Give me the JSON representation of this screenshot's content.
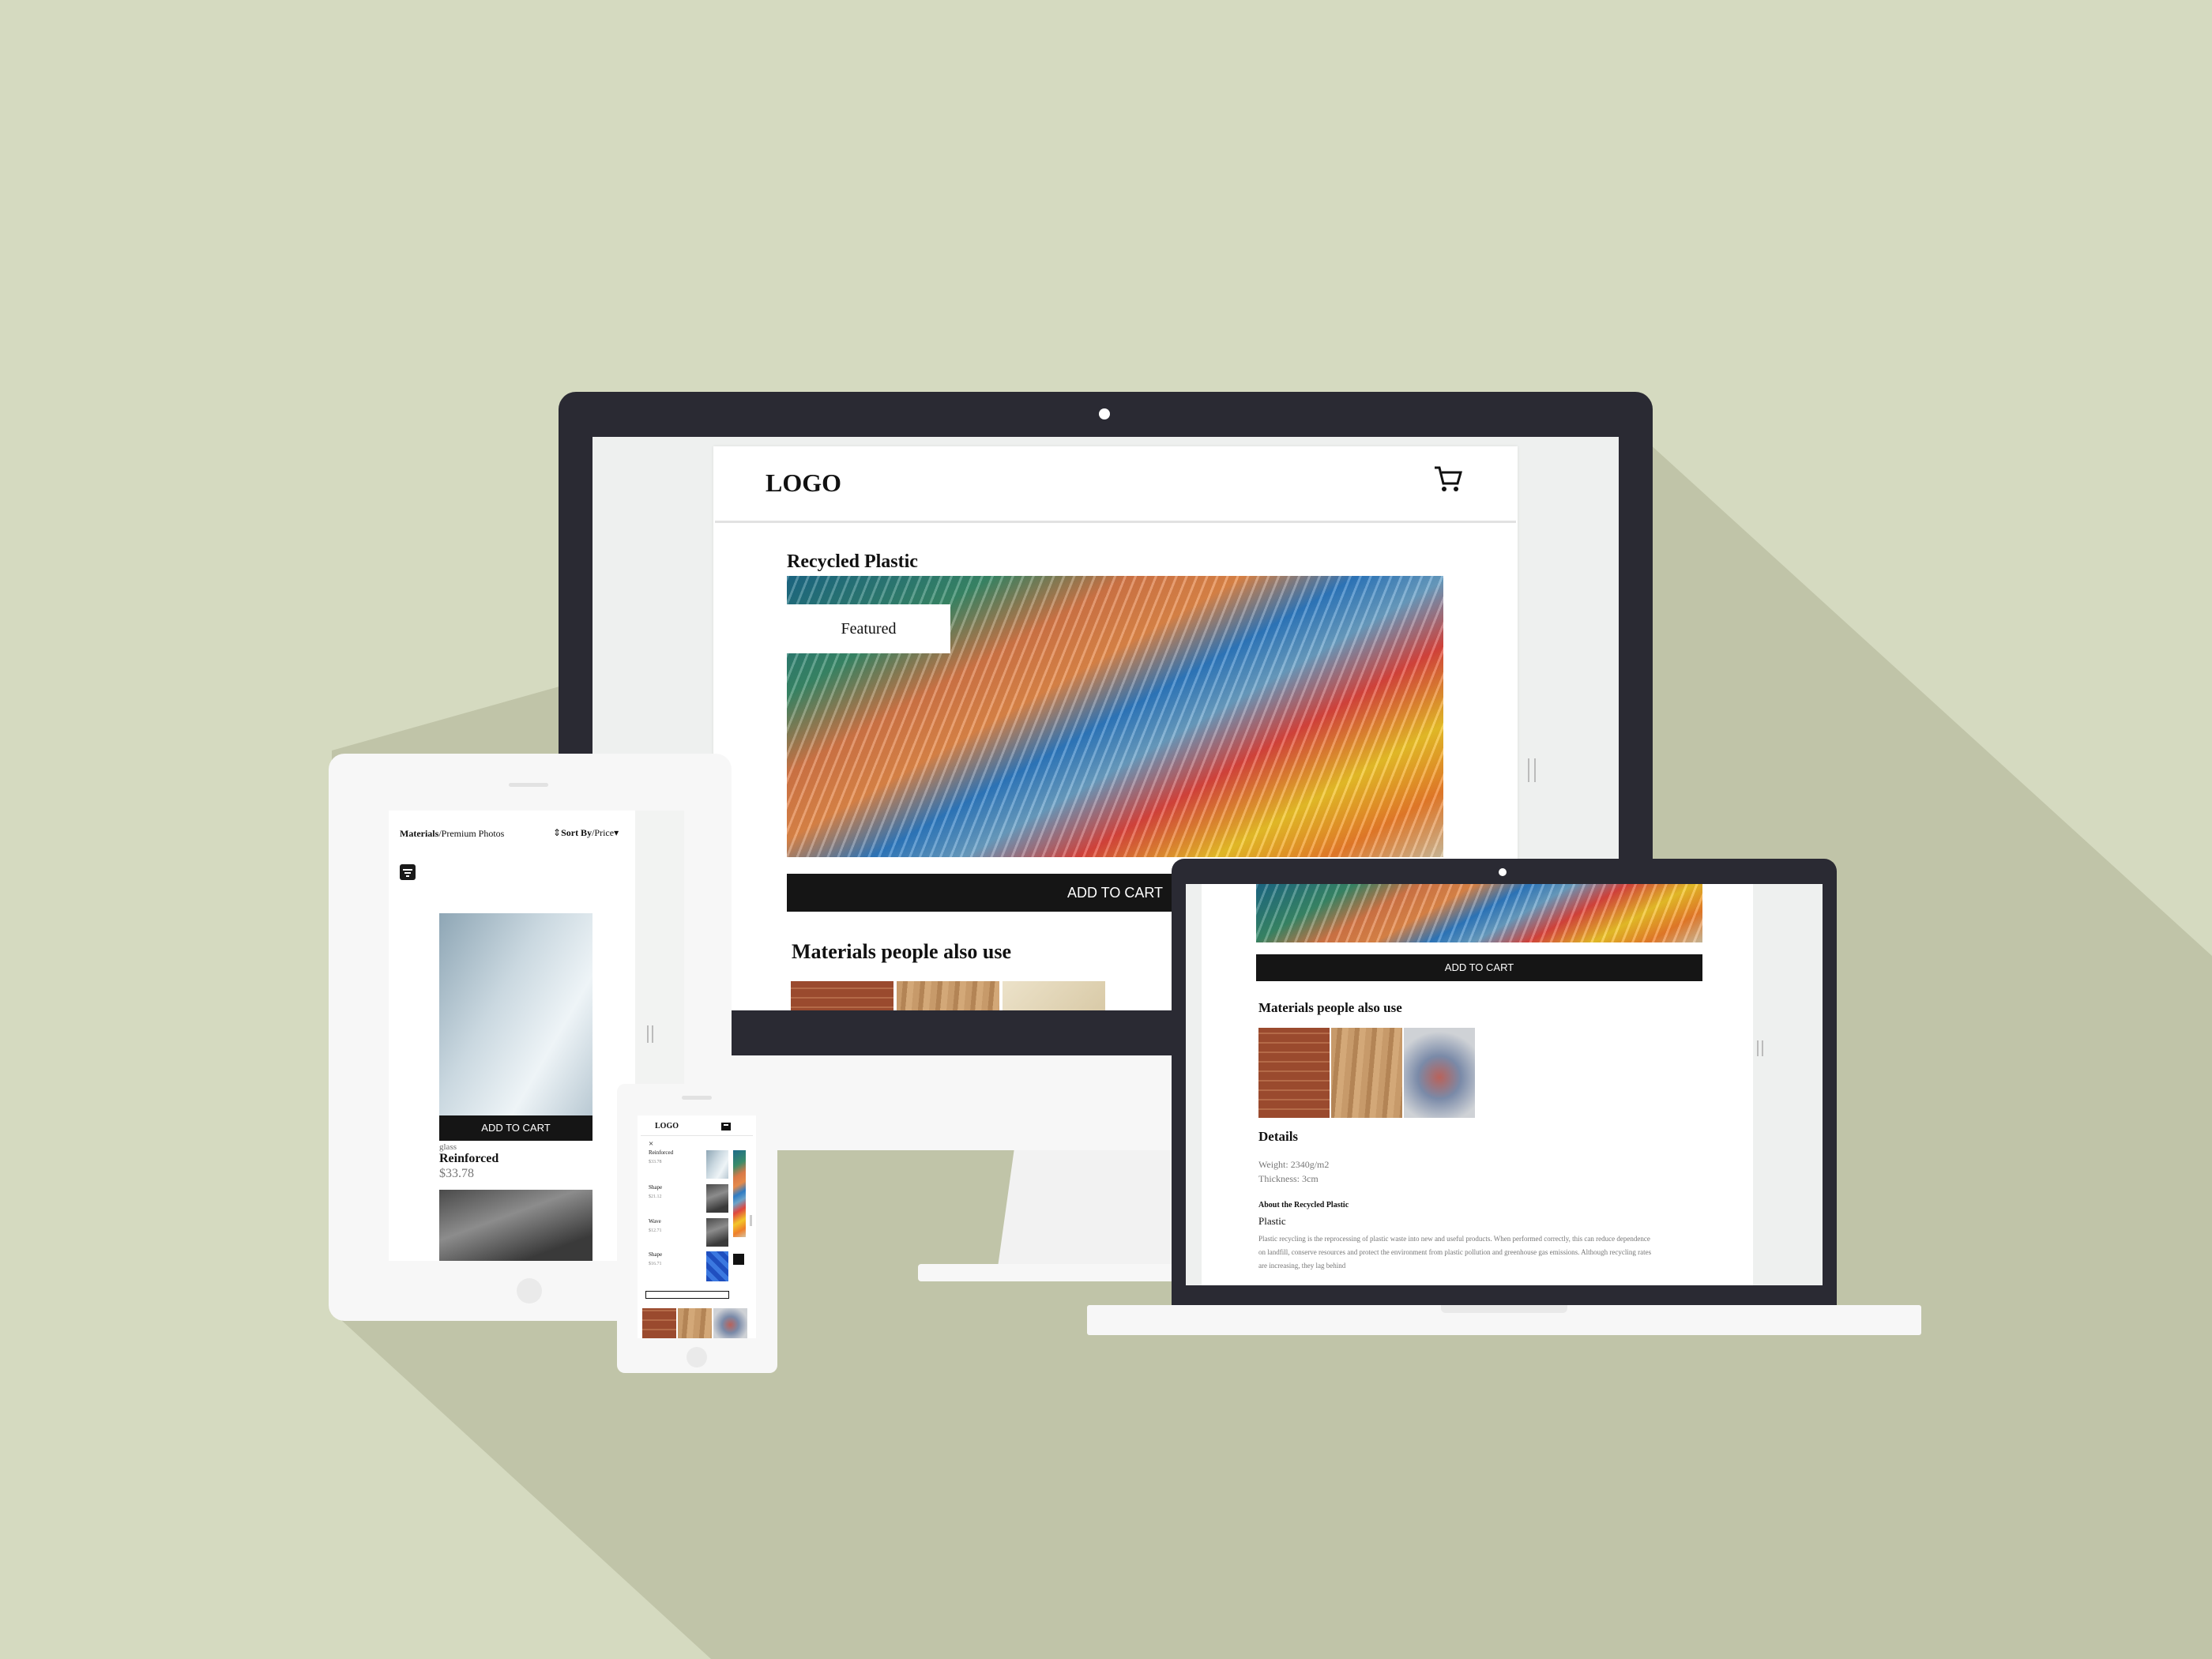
{
  "desktop": {
    "logo": "LOGO",
    "product_title": "Recycled Plastic",
    "featured_badge": "Featured",
    "add_to_cart": "ADD TO CART",
    "also_use_heading": "Materials people also use"
  },
  "tablet": {
    "breadcrumb_root": "Materials",
    "breadcrumb_sep": "/",
    "breadcrumb_page": "Premium Photos",
    "sort_label": "Sort By",
    "sort_value": "/Price",
    "add_to_cart": "ADD TO CART",
    "product_category": "glass",
    "product_name": "Reinforced",
    "product_price": "$33.78"
  },
  "phone": {
    "logo": "LOGO",
    "close": "×",
    "items": [
      {
        "name": "Reinforced",
        "price": "$33.78"
      },
      {
        "name": "Shape",
        "price": "$21.12"
      },
      {
        "name": "Wave",
        "price": "$12.71"
      },
      {
        "name": "Shape",
        "price": "$16.71"
      }
    ]
  },
  "laptop": {
    "add_to_cart": "ADD TO CART",
    "also_use_heading": "Materials people also use",
    "details_heading": "Details",
    "weight": "Weight: 2340g/m2",
    "thickness": "Thickness: 3cm",
    "about_heading": "About the Recycled Plastic",
    "about_sub": "Plastic",
    "about_text": "Plastic recycling is the reprocessing of plastic waste into new and useful products. When performed correctly, this can reduce dependence on landfill, conserve resources and protect the environment from plastic pollution and greenhouse gas emissions. Although recycling rates are increasing, they lag behind"
  }
}
